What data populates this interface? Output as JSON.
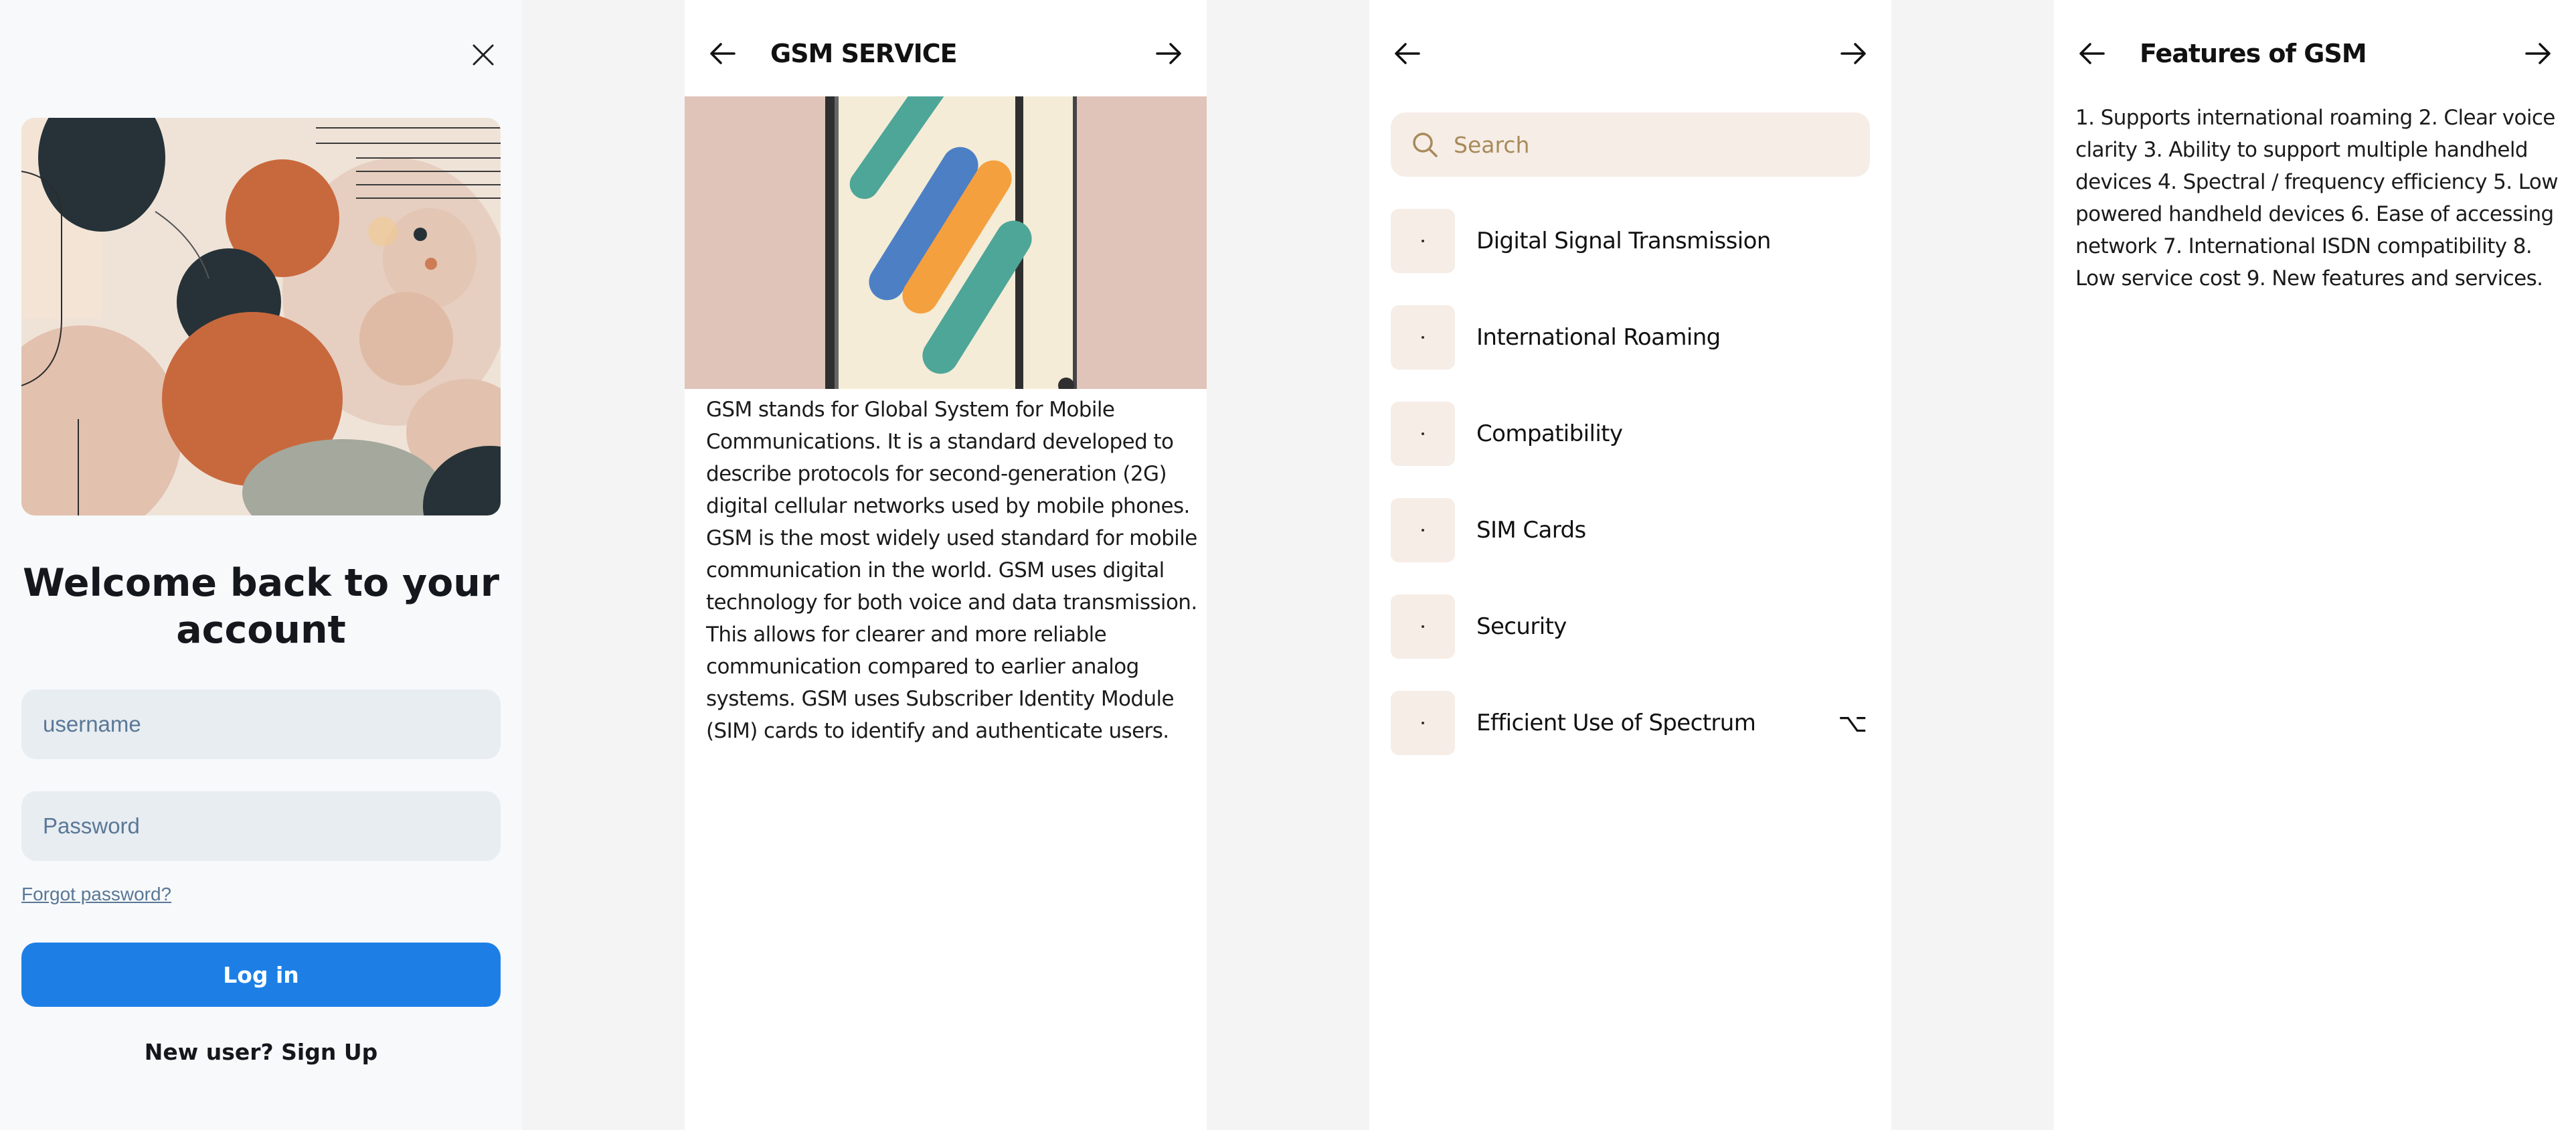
{
  "login": {
    "welcome_title": "Welcome back to your account",
    "username_placeholder": "username",
    "password_placeholder": "Password",
    "forgot_label": "Forgot password?",
    "login_label": "Log in",
    "signup_label": "New user? Sign Up",
    "close_icon": "close-icon",
    "accent": "#1d7fe6"
  },
  "service": {
    "title": "GSM SERVICE",
    "body": "GSM stands for Global System for Mobile Communications. It is a standard developed to describe protocols for second-generation (2G) digital cellular networks used by mobile phones. GSM is the most widely used standard for mobile communication in the world. GSM uses digital technology for both voice and data transmission. This allows for clearer and more reliable communication compared to earlier analog systems. GSM uses Subscriber Identity Module (SIM) cards to identify and authenticate users."
  },
  "topics": {
    "search_placeholder": "Search",
    "items": [
      {
        "label": "Digital Signal Transmission"
      },
      {
        "label": "International Roaming"
      },
      {
        "label": "Compatibility"
      },
      {
        "label": "SIM Cards"
      },
      {
        "label": "Security"
      },
      {
        "label": "Efficient Use of Spectrum",
        "extra": "⌥"
      }
    ]
  },
  "features": {
    "title": "Features of GSM",
    "body": "1. Supports international roaming 2. Clear voice clarity 3. Ability to support multiple handheld devices 4. Spectral / frequency efficiency 5. Low powered handheld devices 6. Ease of accessing network 7. International ISDN compatibility 8. Low service cost 9. New features and services."
  }
}
